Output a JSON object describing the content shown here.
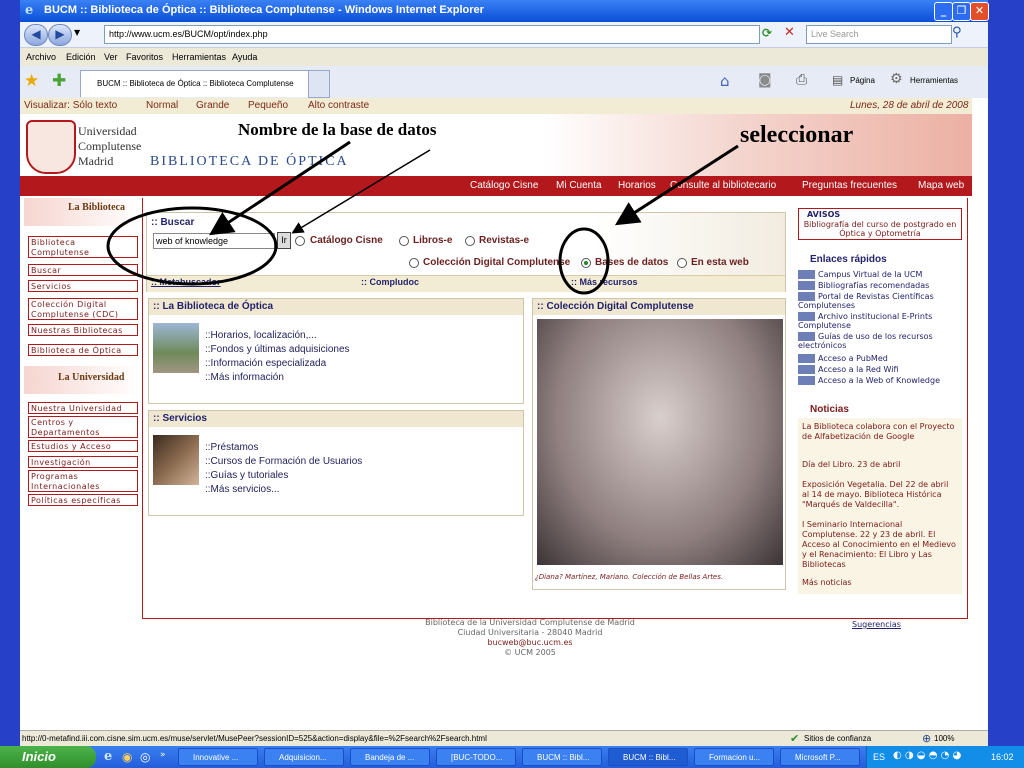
{
  "window": {
    "title": "BUCM :: Biblioteca de Óptica :: Biblioteca Complutense - Windows Internet Explorer",
    "url": "http://www.ucm.es/BUCM/opt/index.php",
    "live_search_placeholder": "Live Search",
    "menu": [
      "Archivo",
      "Edición",
      "Ver",
      "Favoritos",
      "Herramientas",
      "Ayuda"
    ],
    "tab_label": "BUCM :: Biblioteca de Óptica :: Biblioteca Complutense",
    "toolbar": {
      "page": "Página",
      "tools": "Herramientas"
    }
  },
  "page": {
    "topbar": {
      "view_label": "Visualizar: Sólo texto",
      "options": [
        "Normal",
        "Grande",
        "Pequeño",
        "Alto contraste"
      ],
      "date": "Lunes, 28 de abril de 2008"
    },
    "logo": {
      "line1": "Universidad",
      "line2": "Complutense",
      "line3": "Madrid"
    },
    "site_title": "BIBLIOTECA DE ÓPTICA",
    "nav": [
      "Catálogo Cisne",
      "Mi Cuenta",
      "Horarios",
      "Consulte al bibliotecario",
      "Preguntas frecuentes",
      "Mapa web"
    ],
    "left": {
      "section1": "La Biblioteca",
      "items1": [
        "Biblioteca Complutense",
        "Buscar",
        "Servicios",
        "Colección Digital Complutense (CDC)",
        "Nuestras Bibliotecas",
        "Biblioteca de Óptica"
      ],
      "section2": "La Universidad",
      "items2": [
        "Nuestra Universidad",
        "Centros y Departamentos",
        "Estudios y Acceso",
        "Investigación",
        "Programas Internacionales",
        "Políticas específicas"
      ]
    },
    "search": {
      "title": ":: Buscar",
      "value": "web of knowledge",
      "go": "Ir",
      "options_row1": [
        "Catálogo Cisne",
        "Libros-e",
        "Revistas-e"
      ],
      "options_row2": [
        "Colección Digital Complutense",
        "Bases de datos",
        "En esta web"
      ],
      "links": [
        ":: Metabuscador",
        ":: Compludoc",
        ":: Más recursos"
      ]
    },
    "biblioteca_box": {
      "title": ":: La Biblioteca de Óptica",
      "items": [
        "::Horarios, localización,...",
        "::Fondos y últimas adquisiciones",
        "::Información especializada",
        "::Más información"
      ]
    },
    "servicios_box": {
      "title": ":: Servicios",
      "items": [
        "::Préstamos",
        "::Cursos de Formación de Usuarios",
        "::Guías y tutoriales",
        "::Más servicios..."
      ]
    },
    "coleccion_box": {
      "title": ":: Colección Digital Complutense",
      "caption": "¿Diana? Martínez, Mariano. Colección de Bellas Artes."
    },
    "avisos": {
      "title": "AVISOS",
      "text": "Bibliografía del curso de postgrado en Óptica y Optometría"
    },
    "enlaces": {
      "title": "Enlaces rápidos",
      "items": [
        "Campus Virtual de la UCM",
        "Bibliografías recomendadas",
        "Portal de Revistas Científicas Complutenses",
        "Archivo institucional E-Prints Complutense",
        "Guías de uso de los recursos electrónicos",
        "Acceso a PubMed",
        "Acceso a la Red Wifi",
        "Acceso a la Web of Knowledge"
      ]
    },
    "noticias": {
      "title": "Noticias",
      "items": [
        "La Biblioteca colabora con el Proyecto de Alfabetización de Google",
        "Día del Libro. 23 de abril",
        "Exposición Vegetalia. Del 22 de abril al 14 de mayo. Biblioteca Histórica \"Marqués de Valdecilla\".",
        "I Seminario Internacional Complutense. 22 y 23 de abril. El Acceso al Conocimiento en el Medievo y el Renacimiento: El Libro y Las Bibliotecas",
        "Más noticias"
      ]
    },
    "footer": {
      "line1": "Biblioteca de la Universidad Complutense de Madrid",
      "line2": "Ciudad Universitaria - 28040 Madrid",
      "line3": "bucweb@buc.ucm.es",
      "line4": "© UCM 2005",
      "sugerencias": "Sugerencias"
    }
  },
  "annotations": {
    "field_label": "Nombre de la base de datos",
    "select_label": "seleccionar"
  },
  "status": {
    "url": "http://0-metafind.iii.com.cisne.sim.ucm.es/muse/servlet/MusePeer?sessionID=525&action=display&file=%2Fsearch%2Fsearch.html",
    "zone": "Sitios de confianza",
    "zoom": "100%"
  },
  "taskbar": {
    "start": "Inicio",
    "tasks": [
      "Innovative ...",
      "Adquisicion...",
      "Bandeja de ...",
      "[BUC-TODO...",
      "BUCM :: Bibl...",
      "BUCM :: Bibl...",
      "Formacion u...",
      "Microsoft P..."
    ],
    "lang": "ES",
    "time": "16:02"
  }
}
